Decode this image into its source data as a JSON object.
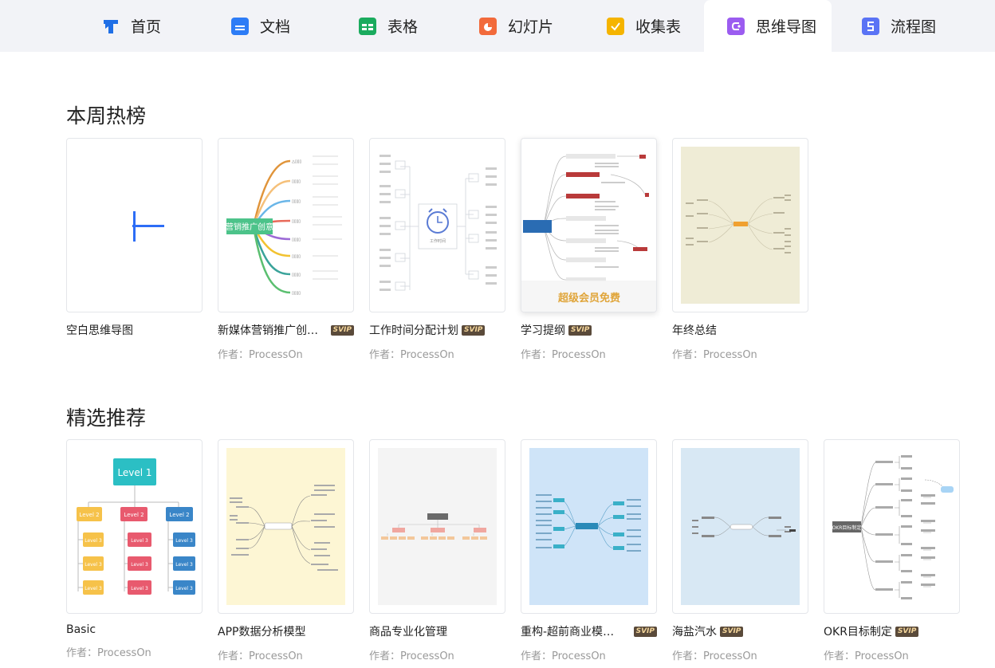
{
  "tabs": [
    {
      "label": "首页",
      "icon": "home-icon",
      "color": "#1f6fe6"
    },
    {
      "label": "文档",
      "icon": "doc-icon",
      "color": "#2d7cf6"
    },
    {
      "label": "表格",
      "icon": "sheet-icon",
      "color": "#1bab5e"
    },
    {
      "label": "幻灯片",
      "icon": "slides-icon",
      "color": "#f26a3b"
    },
    {
      "label": "收集表",
      "icon": "form-icon",
      "color": "#f5b400"
    },
    {
      "label": "思维导图",
      "icon": "mindmap-icon",
      "color": "#9b5cf0"
    },
    {
      "label": "流程图",
      "icon": "flowchart-icon",
      "color": "#5a73f5"
    }
  ],
  "sections": {
    "hot": {
      "title": "本周热榜",
      "cards": [
        {
          "name": "空白思维导图",
          "author": "",
          "svip": ""
        },
        {
          "name": "新媒体营销推广创意...",
          "author": "作者：ProcessOn",
          "svip": "SVIP",
          "center_label": "营销推广创意"
        },
        {
          "name": "工作时间分配计划",
          "author": "作者：ProcessOn",
          "svip": "SVIP",
          "center_label": "工作时间"
        },
        {
          "name": "学习提纲",
          "author": "作者：ProcessOn",
          "svip": "SVIP",
          "overlay": "超级会员免费"
        },
        {
          "name": "年终总结",
          "author": "作者：ProcessOn",
          "svip": ""
        }
      ]
    },
    "featured": {
      "title": "精选推荐",
      "cards": [
        {
          "name": "Basic",
          "author": "作者：ProcessOn",
          "svip": "",
          "level1": "Level 1",
          "level2": "Level 2",
          "level3": "Level 3"
        },
        {
          "name": "APP数据分析模型",
          "author": "作者：ProcessOn",
          "svip": ""
        },
        {
          "name": "商品专业化管理",
          "author": "作者：ProcessOn",
          "svip": ""
        },
        {
          "name": "重构-超前商业模式...",
          "author": "作者：ProcessOn",
          "svip": "SVIP"
        },
        {
          "name": "海盐汽水",
          "author": "作者：ProcessOn",
          "svip": "SVIP"
        },
        {
          "name": "OKR目标制定",
          "author": "作者：ProcessOn",
          "svip": "SVIP",
          "center_label": "OKR目标制定"
        }
      ]
    }
  },
  "colors": {
    "accent": "#2d6df6",
    "tab_bg": "#f2f3f7"
  }
}
